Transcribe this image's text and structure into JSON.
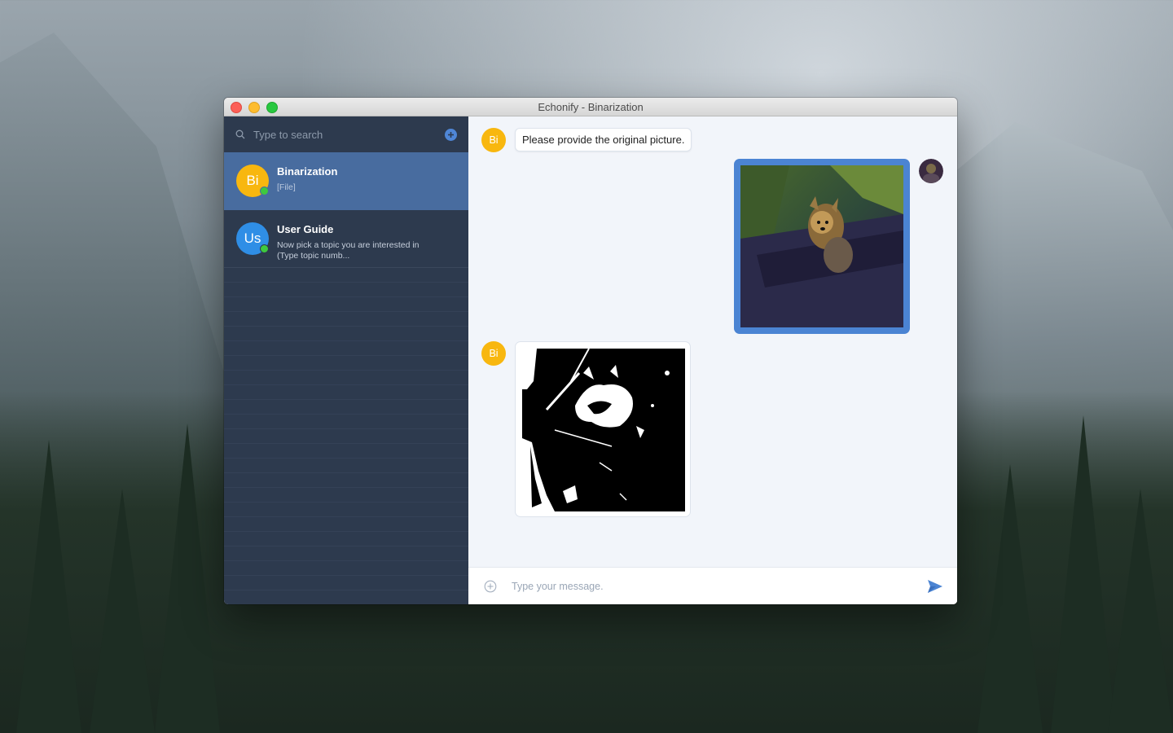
{
  "window": {
    "title": "Echonify - Binarization"
  },
  "sidebar": {
    "search_placeholder": "Type to search",
    "conversations": [
      {
        "initials": "Bi",
        "name": "Binarization",
        "preview": "[File]",
        "avatar_color": "#f8b70f",
        "online": true,
        "active": true
      },
      {
        "initials": "Us",
        "name": "User Guide",
        "preview": "Now pick a topic you are interested in (Type topic numb...",
        "avatar_color": "#2f8ee6",
        "online": true,
        "active": false
      }
    ]
  },
  "chat": {
    "messages": [
      {
        "from": "bot",
        "initials": "Bi",
        "type": "text",
        "text": "Please provide the original picture."
      },
      {
        "from": "user",
        "type": "image",
        "image": "yorkshire-terrier-in-car-window"
      },
      {
        "from": "bot",
        "initials": "Bi",
        "type": "image",
        "image": "binarized-dog-photo"
      }
    ],
    "composer_placeholder": "Type your message."
  },
  "colors": {
    "sidebar_bg": "#2d3a4e",
    "active_item": "#486c9f",
    "accent": "#4b84d3",
    "bot_avatar": "#f8b70f",
    "online": "#3ec93e"
  },
  "icons": [
    "search-icon",
    "add-icon",
    "attach-icon",
    "send-icon"
  ]
}
